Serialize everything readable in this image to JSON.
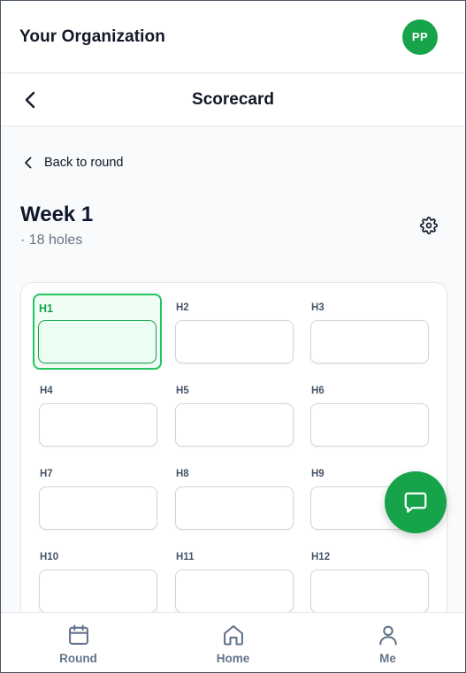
{
  "org": {
    "name": "Your Organization",
    "avatar_initials": "PP"
  },
  "header": {
    "title": "Scorecard"
  },
  "back_link": {
    "label": "Back to round"
  },
  "round": {
    "title": "Week 1",
    "subtitle": "· 18 holes"
  },
  "holes": [
    {
      "label": "H1",
      "value": "",
      "active": true
    },
    {
      "label": "H2",
      "value": "",
      "active": false
    },
    {
      "label": "H3",
      "value": "",
      "active": false
    },
    {
      "label": "H4",
      "value": "",
      "active": false
    },
    {
      "label": "H5",
      "value": "",
      "active": false
    },
    {
      "label": "H6",
      "value": "",
      "active": false
    },
    {
      "label": "H7",
      "value": "",
      "active": false
    },
    {
      "label": "H8",
      "value": "",
      "active": false
    },
    {
      "label": "H9",
      "value": "",
      "active": false
    },
    {
      "label": "H10",
      "value": "",
      "active": false
    },
    {
      "label": "H11",
      "value": "",
      "active": false
    },
    {
      "label": "H12",
      "value": "",
      "active": false
    }
  ],
  "nav": [
    {
      "label": "Round",
      "icon": "calendar-icon"
    },
    {
      "label": "Home",
      "icon": "home-icon"
    },
    {
      "label": "Me",
      "icon": "user-icon"
    }
  ],
  "colors": {
    "accent": "#16a34a",
    "active_border": "#22c55e",
    "active_bg": "#f0fdf4"
  }
}
